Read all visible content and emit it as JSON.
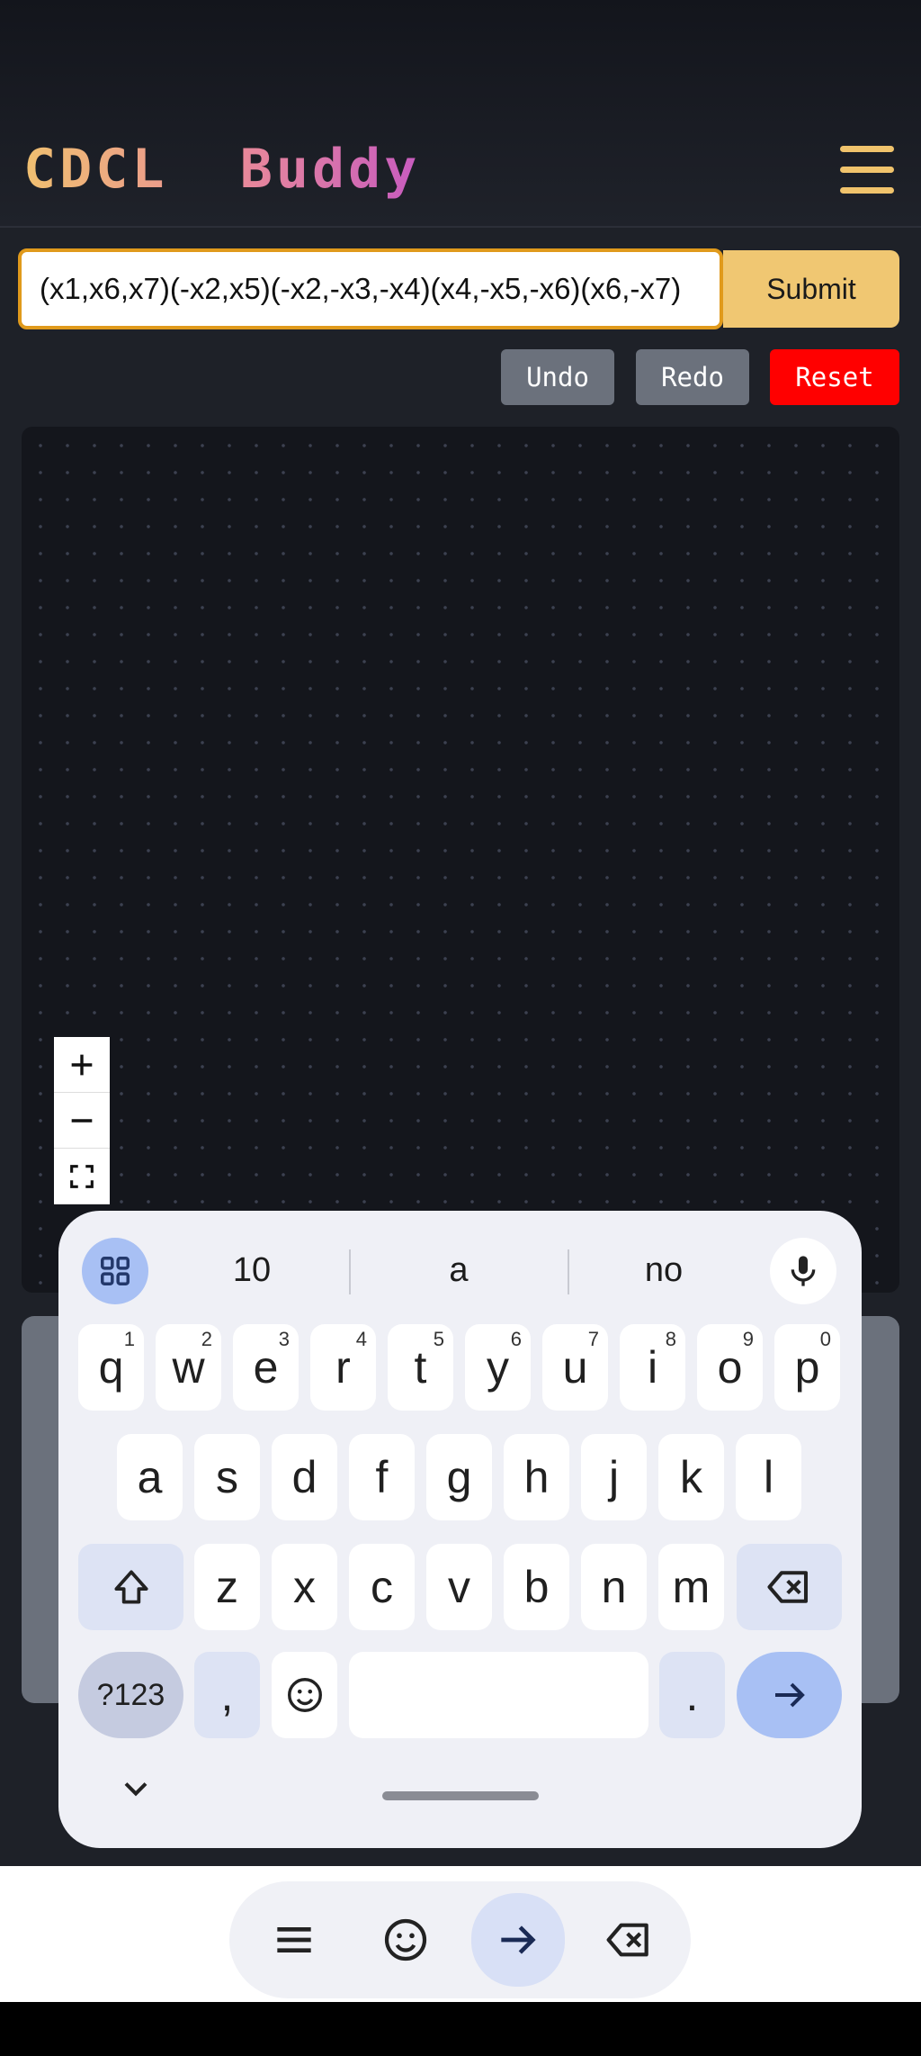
{
  "app": {
    "title_part1": "CDCL",
    "title_part2": "Buddy"
  },
  "formula": {
    "value": "(x1,x6,x7)(-x2,x5)(-x2,-x3,-x4)(x4,-x5,-x6)(x6,-x7)",
    "submit_label": "Submit"
  },
  "history": {
    "undo_label": "Undo",
    "redo_label": "Redo",
    "reset_label": "Reset"
  },
  "zoom_controls": [
    "zoom-in",
    "zoom-out",
    "fit-view"
  ],
  "keyboard": {
    "suggestions": [
      "10",
      "a",
      "no"
    ],
    "row1": [
      {
        "k": "q",
        "s": "1"
      },
      {
        "k": "w",
        "s": "2"
      },
      {
        "k": "e",
        "s": "3"
      },
      {
        "k": "r",
        "s": "4"
      },
      {
        "k": "t",
        "s": "5"
      },
      {
        "k": "y",
        "s": "6"
      },
      {
        "k": "u",
        "s": "7"
      },
      {
        "k": "i",
        "s": "8"
      },
      {
        "k": "o",
        "s": "9"
      },
      {
        "k": "p",
        "s": "0"
      }
    ],
    "row2": [
      "a",
      "s",
      "d",
      "f",
      "g",
      "h",
      "j",
      "k",
      "l"
    ],
    "row3": [
      "z",
      "x",
      "c",
      "v",
      "b",
      "n",
      "m"
    ],
    "symbols_label": "?123",
    "comma_label": ",",
    "period_label": "."
  },
  "colors": {
    "accent": "#f0c772",
    "reset": "#ff0000",
    "input_border": "#e09a1c"
  }
}
